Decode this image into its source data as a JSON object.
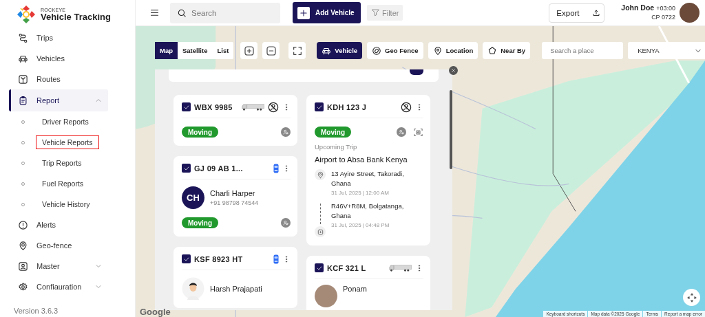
{
  "brand": {
    "company": "ROCKEYE",
    "product": "Vehicle Tracking"
  },
  "sidebar": {
    "items": [
      {
        "kind": "link",
        "label": "Trips",
        "selected": false
      },
      {
        "kind": "link",
        "label": "Vehicles",
        "selected": false
      },
      {
        "kind": "link",
        "label": "Routes",
        "selected": false
      },
      {
        "kind": "group",
        "label": "Report",
        "selected": true,
        "expanded": true,
        "children": [
          {
            "label": "Driver Reports",
            "selected": false
          },
          {
            "label": "Vehicle Reports",
            "selected": true
          },
          {
            "label": "Trip Reports",
            "selected": false
          },
          {
            "label": "Fuel Reports",
            "selected": false
          },
          {
            "label": "Vehicle History",
            "selected": false
          }
        ]
      },
      {
        "kind": "link",
        "label": "Alerts",
        "selected": false
      },
      {
        "kind": "link",
        "label": "Geo-fence",
        "selected": false
      },
      {
        "kind": "group",
        "label": "Master",
        "selected": false,
        "expanded": false
      },
      {
        "kind": "group",
        "label": "Confiauration",
        "selected": false,
        "expanded": false
      }
    ],
    "version": "Version 3.6.3"
  },
  "header": {
    "search": {
      "placeholder": "Search"
    },
    "add_button": "Add Vehicle",
    "filter_button": "Filter",
    "export_button": "Export",
    "user": {
      "name": "John Doe",
      "timezone": "+03:00",
      "code": "CP 0722"
    }
  },
  "map": {
    "view_tabs": [
      {
        "label": "Map",
        "selected": true
      },
      {
        "label": "Satellite",
        "selected": false
      },
      {
        "label": "List",
        "selected": false
      }
    ],
    "layers": [
      {
        "label": "Vehicle",
        "selected": true
      },
      {
        "label": "Geo Fence",
        "selected": false
      },
      {
        "label": "Location",
        "selected": false
      },
      {
        "label": "Near By",
        "selected": false
      }
    ],
    "place_search": {
      "placeholder": "Search a place"
    },
    "country": {
      "value": "KENYA"
    },
    "logo": "Google",
    "attribution": [
      "Keyboard shortcuts",
      "Map data ©2025 Google",
      "Terms",
      "Report a map error"
    ]
  },
  "vehicle_panel": {
    "navigate_toggle": {
      "on": true
    },
    "columns": [
      [
        {
          "plate": "WBX 9985",
          "checked": true,
          "kind": "truck",
          "unassigned": true,
          "status": "Moving"
        },
        {
          "plate": "GJ 09 AB 1...",
          "checked": true,
          "kind": "car",
          "unassigned": false,
          "driver": {
            "kind": "initials",
            "initials": "CH",
            "name": "Charli Harper",
            "phone": "+91 98798 74544"
          },
          "status": "Moving"
        },
        {
          "plate": "KSF 8923 HT",
          "checked": true,
          "kind": "car",
          "unassigned": false,
          "driver": {
            "kind": "silhouette",
            "name": "Harsh Prajapati"
          }
        }
      ],
      [
        {
          "plate": "KDH 123 J",
          "checked": true,
          "kind": "none",
          "unassigned": true,
          "status": "Moving",
          "trip": {
            "heading": "Upcoming Trip",
            "title": "Airport to Absa Bank Kenya",
            "stops": [
              {
                "kind": "pickup",
                "address": "13 Ayire Street, Takoradi, Ghana",
                "time": "31 Jul, 2025 | 12:00 AM"
              },
              {
                "kind": "drop",
                "address": "R46V+R8M, Bolgatanga, Ghana",
                "time": "31 Jul, 2025 | 04:48 PM"
              }
            ]
          }
        },
        {
          "plate": "KCF 321 L",
          "checked": true,
          "kind": "truck",
          "unassigned": false,
          "driver": {
            "kind": "photo",
            "name": "Ponam"
          }
        }
      ]
    ]
  }
}
